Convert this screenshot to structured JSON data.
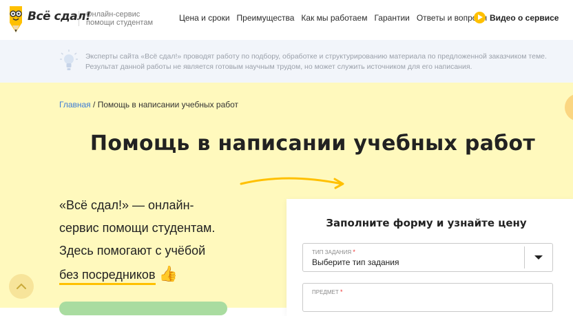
{
  "header": {
    "logo_text": "Всё сдал!",
    "tagline_line1": "Онлайн-сервис",
    "tagline_line2": "помощи студентам",
    "nav": [
      {
        "label": "Цена и сроки"
      },
      {
        "label": "Преимущества"
      },
      {
        "label": "Как мы работаем"
      },
      {
        "label": "Гарантии"
      },
      {
        "label": "Ответы и вопросы"
      }
    ],
    "video_label": "Видео о сервисе",
    "play_icon": "play-icon"
  },
  "notice": {
    "icon": "lightbulb-icon",
    "line1": "Эксперты сайта «Всё сдал!» проводят работу по подбору, обработке и структурированию материала по предложенной заказчиком теме.",
    "line2": "Результат данной работы не является готовым научным трудом, но может служить источником для его написания."
  },
  "breadcrumb": {
    "home": "Главная",
    "separator": "/",
    "current": "Помощь в написании учебных работ"
  },
  "hero": {
    "title": "Помощь в написании учебных работ",
    "intro_line1": "«Всё сдал!» — онлайн-",
    "intro_line2": "сервис помощи студентам.",
    "intro_line3": "Здесь помогают с учёбой",
    "intro_line4": "без посредников",
    "thumb": "👍"
  },
  "form": {
    "title": "Заполните форму и узнайте цену",
    "field1_label": "Тип задания",
    "field1_star": "*",
    "field1_value": "Выберите тип задания",
    "field2_label": "Предмет",
    "field2_star": "*"
  },
  "colors": {
    "accent_yellow": "#ffc000",
    "hero_bg": "#fff9bd",
    "link_blue": "#3a7bd5"
  }
}
